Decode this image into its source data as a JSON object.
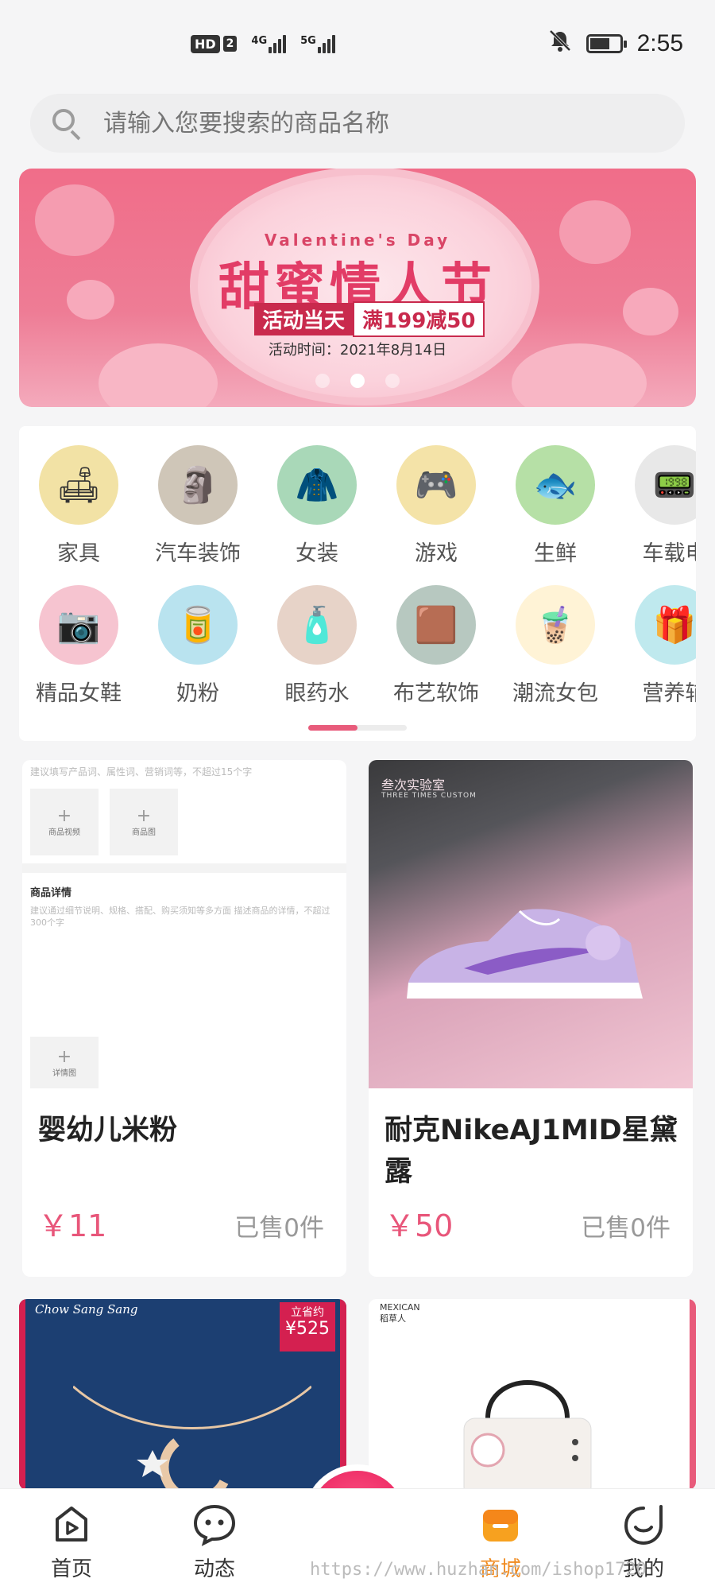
{
  "status_bar": {
    "hd": "HD",
    "sim": "2",
    "net1": "4G",
    "net2": "5G",
    "time": "2:55"
  },
  "search": {
    "placeholder": "请输入您要搜索的商品名称"
  },
  "banner": {
    "subtitle": "Valentine's Day",
    "title": "甜蜜情人节",
    "promo_left": "活动当天",
    "promo_right": "满199减50",
    "date": "活动时间：2021年8月14日",
    "active_dot": 1
  },
  "categories": {
    "row1": [
      {
        "label": "家具",
        "icon": "sofa-icon",
        "bg": "#f2e2a5",
        "glyph": "🛋"
      },
      {
        "label": "汽车装饰",
        "icon": "car-ornament-icon",
        "bg": "#cfc6b8",
        "glyph": "🗿"
      },
      {
        "label": "女装",
        "icon": "coat-icon",
        "bg": "#a9d8b8",
        "glyph": "🧥"
      },
      {
        "label": "游戏",
        "icon": "game-console-icon",
        "bg": "#f4e3a8",
        "glyph": "🎮"
      },
      {
        "label": "生鲜",
        "icon": "salmon-icon",
        "bg": "#b6e0a6",
        "glyph": "🐟"
      },
      {
        "label": "车载电",
        "icon": "car-device-icon",
        "bg": "#e8e8e8",
        "glyph": "📟"
      }
    ],
    "row2": [
      {
        "label": "精品女鞋",
        "icon": "camera-icon",
        "bg": "#f6c4d0",
        "glyph": "📷"
      },
      {
        "label": "奶粉",
        "icon": "milk-powder-icon",
        "bg": "#b9e3ef",
        "glyph": "🥫"
      },
      {
        "label": "眼药水",
        "icon": "eye-drops-icon",
        "bg": "#e7d3c8",
        "glyph": "🧴"
      },
      {
        "label": "布艺软饰",
        "icon": "rug-icon",
        "bg": "#b7c8c0",
        "glyph": "🟫"
      },
      {
        "label": "潮流女包",
        "icon": "milk-tea-icon",
        "bg": "#fff3d6",
        "glyph": "🧋"
      },
      {
        "label": "营养辅",
        "icon": "supplement-icon",
        "bg": "#bfe9ee",
        "glyph": "🎁"
      }
    ]
  },
  "products": [
    {
      "name": "婴幼儿米粉",
      "price": "￥11",
      "sold": "已售0件",
      "image": {
        "hint": "建议填写产品词、属性词、营销词等，不超过15个字",
        "video_label": "商品视频",
        "image_label": "商品图",
        "detail_title": "商品详情",
        "detail_hint": "建议通过细节说明、规格、搭配、购买须知等多方面 描述商品的详情，不超过300个字",
        "detail_img_label": "详情图"
      }
    },
    {
      "name": "耐克NikeAJ1MID星黛露",
      "price": "￥50",
      "sold": "已售0件",
      "image": {
        "brand": "叁次实验室",
        "brand_en": "THREE TIMES CUSTOM"
      }
    },
    {
      "image": {
        "brand": "Chow Sang Sang",
        "tag_top": "立省约",
        "tag_value": "¥525"
      }
    },
    {
      "image": {
        "brand_en": "MEXICAN",
        "brand_cn": "稻草人"
      }
    }
  ],
  "tabbar": {
    "items": [
      {
        "label": "首页",
        "icon": "home-play-icon"
      },
      {
        "label": "动态",
        "icon": "chat-bubble-icon"
      },
      {
        "label": "",
        "icon": "camera-lens-icon"
      },
      {
        "label": "商城",
        "icon": "shop-bag-icon"
      },
      {
        "label": "我的",
        "icon": "smile-profile-icon"
      }
    ],
    "active_color": "#f08a1e"
  },
  "watermark": "https://www.huzhan.com/ishop1720",
  "colors": {
    "accent": "#e85b7b",
    "banner": "#f06d89",
    "price": "#e8567a"
  }
}
